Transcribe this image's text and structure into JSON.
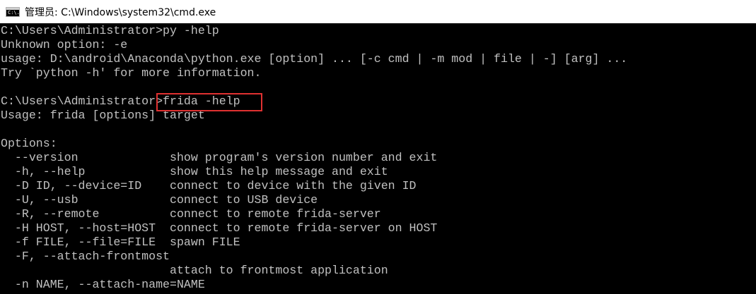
{
  "window": {
    "title": "管理员: C:\\Windows\\system32\\cmd.exe",
    "icon": "cmd-icon",
    "icon_glyph": "C:\\."
  },
  "colors": {
    "console_background": "#000000",
    "console_text": "#c0c0c0",
    "highlight_border": "#e03131"
  },
  "console": {
    "lines": [
      "C:\\Users\\Administrator>py -help",
      "Unknown option: -e",
      "usage: D:\\android\\Anaconda\\python.exe [option] ... [-c cmd | -m mod | file | -] [arg] ...",
      "Try `python -h' for more information.",
      "",
      "C:\\Users\\Administrator>frida -help",
      "Usage: frida [options] target",
      "",
      "Options:",
      "  --version             show program's version number and exit",
      "  -h, --help            show this help message and exit",
      "  -D ID, --device=ID    connect to device with the given ID",
      "  -U, --usb             connect to USB device",
      "  -R, --remote          connect to remote frida-server",
      "  -H HOST, --host=HOST  connect to remote frida-server on HOST",
      "  -f FILE, --file=FILE  spawn FILE",
      "  -F, --attach-frontmost",
      "                        attach to frontmost application",
      "  -n NAME, --attach-name=NAME"
    ]
  }
}
